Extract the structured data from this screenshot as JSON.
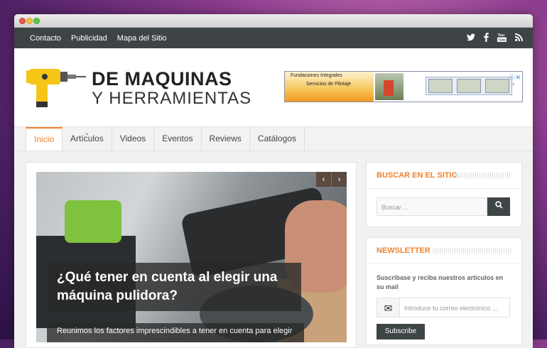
{
  "topbar": {
    "links": [
      "Contacto",
      "Publicidad",
      "Mapa del Sitio"
    ],
    "social_icons": [
      "twitter-icon",
      "facebook-icon",
      "youtube-icon",
      "rss-icon"
    ]
  },
  "logo": {
    "line1": "DE MAQUINAS",
    "line2": "Y HERRAMIENTAS"
  },
  "ad": {
    "line1": "Fundaciones Integrales",
    "line2": "Servicios de Pilotaje"
  },
  "nav": {
    "items": [
      "Inicio",
      "Artículos",
      "Videos",
      "Eventos",
      "Reviews",
      "Catálogos"
    ]
  },
  "slider": {
    "title": "¿Qué tener en cuenta al elegir una máquina pulidora?",
    "excerpt": "Reunimos los factores imprescindibles a tener en cuenta para elegir"
  },
  "search_widget": {
    "title": "BUSCAR EN EL SITIO",
    "placeholder": "Buscar ..."
  },
  "newsletter": {
    "title": "NEWSLETTER",
    "text": "Suscribase y reciba nuestros artículos en su mail",
    "placeholder": "Introduce tu correo electrónico ...",
    "button": "Subscribe"
  },
  "colors": {
    "accent": "#f0812d",
    "topbar": "#3e4346",
    "dark_button": "#3f4547"
  }
}
